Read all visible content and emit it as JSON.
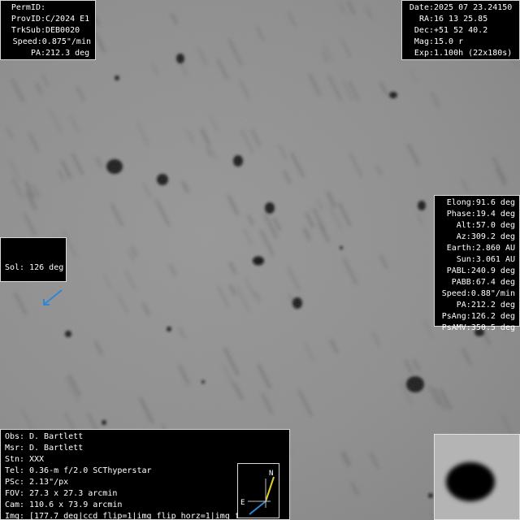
{
  "top_left": {
    "rows": [
      {
        "key": "PermID:",
        "value": ""
      },
      {
        "key": "ProvID:",
        "value": "C/2024 E1"
      },
      {
        "key": "TrkSub:",
        "value": "DEB0020"
      },
      {
        "key": "Speed:",
        "value": "0.875\"/min"
      },
      {
        "key": "PA:",
        "value": "212.3 deg"
      }
    ]
  },
  "top_right": {
    "rows": [
      {
        "key": "Date:",
        "value": "2025 07 23.24150"
      },
      {
        "key": "RA:",
        "value": "16 13 25.85"
      },
      {
        "key": "Dec:",
        "value": "+51 52 40.2"
      },
      {
        "key": "Mag:",
        "value": "15.0 r"
      },
      {
        "key": "Exp:",
        "value": "1.100h (22x180s)"
      }
    ]
  },
  "right_panel": {
    "rows": [
      {
        "key": "Elong:",
        "value": "91.6 deg"
      },
      {
        "key": "Phase:",
        "value": "19.4 deg"
      },
      {
        "key": "Alt:",
        "value": "57.0 deg"
      },
      {
        "key": "Az:",
        "value": "309.2 deg"
      },
      {
        "key": "Earth:",
        "value": "2.860 AU"
      },
      {
        "key": "Sun:",
        "value": "3.061 AU"
      },
      {
        "key": "PABL:",
        "value": "240.9 deg"
      },
      {
        "key": "PABB:",
        "value": "67.4 deg"
      },
      {
        "key": "Speed:",
        "value": "0.88\"/min"
      },
      {
        "key": "PA:",
        "value": "212.2 deg"
      },
      {
        "key": "PsAng:",
        "value": "126.2 deg"
      },
      {
        "key": "PsAMV:",
        "value": "350.5 deg"
      }
    ]
  },
  "sol": {
    "label": "Sol: 126 deg",
    "arrow_color": "#2e86d6"
  },
  "bottom_left": {
    "rows": [
      {
        "key": "Obs:",
        "value": "D. Bartlett"
      },
      {
        "key": "Msr:",
        "value": "D. Bartlett"
      },
      {
        "key": "Stn:",
        "value": "XXX"
      },
      {
        "key": "Tel:",
        "value": "0.36-m f/2.0 SCThyperstar"
      },
      {
        "key": "PSc:",
        "value": "2.13\"/px"
      },
      {
        "key": "FOV:",
        "value": "27.3 x 27.3 arcmin"
      },
      {
        "key": "Cam:",
        "value": "110.6 x 73.9 arcmin"
      },
      {
        "key": "Img:",
        "value": "[177.7 deg|ccd_flip=1|img_flip_horz=1|img_fl"
      }
    ]
  },
  "compass": {
    "north_label": "N",
    "east_label": "E",
    "north_color": "#e0d020",
    "east_color": "#2e86d6"
  }
}
